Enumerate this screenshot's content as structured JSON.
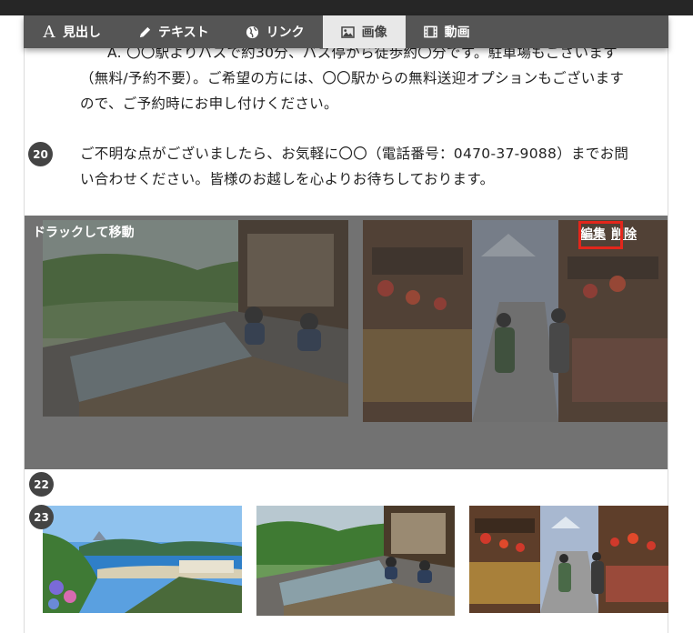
{
  "toolbar": {
    "items": [
      {
        "label": "見出し",
        "icon": "heading-icon",
        "active": false
      },
      {
        "label": "テキスト",
        "icon": "pencil-icon",
        "active": false
      },
      {
        "label": "リンク",
        "icon": "globe-icon",
        "active": false
      },
      {
        "label": "画像",
        "icon": "image-icon",
        "active": true
      },
      {
        "label": "動画",
        "icon": "film-icon",
        "active": false
      }
    ]
  },
  "blocks": {
    "b19": {
      "lines": [
        "A. 〇〇駅よりバスで約30分、バス停から徒歩約〇分です。駐車場もございます",
        "（無料/予約不要）。ご希望の方には、〇〇駅からの無料送迎オプションもございます",
        "ので、ご予約時にお申し付けください。"
      ]
    },
    "b20": {
      "number": "20",
      "lines": [
        "ご不明な点がございましたら、お気軽に〇〇（電話番号：0470-37-9088）までお問",
        "い合わせください。皆様のお越しを心よりお待ちしております。"
      ]
    },
    "b21": {
      "drag_label": "ドラックして移動",
      "edit_label": "編集",
      "delete_label": "削除",
      "images": [
        "onsen-photo",
        "street-photo"
      ]
    },
    "b22": {
      "number": "22"
    },
    "b23": {
      "number": "23",
      "images": [
        "coast-photo",
        "onsen-photo",
        "street-photo"
      ]
    }
  },
  "colors": {
    "toolbar_bg": "#555555",
    "active_tab_bg": "#e8e8e8",
    "highlight": "#e3261b",
    "badge_bg": "#444444"
  }
}
